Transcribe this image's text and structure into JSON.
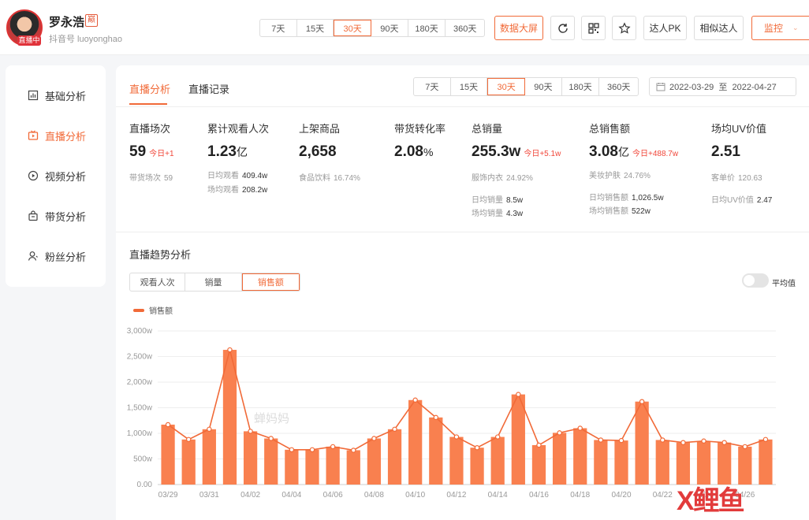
{
  "header": {
    "user_name": "罗永浩",
    "user_tag": "巅",
    "douyin_id": "抖音号 luoyonghao",
    "live_badge": "直播中",
    "period_options": [
      "7天",
      "15天",
      "30天",
      "90天",
      "180天",
      "360天"
    ],
    "period_active": "30天",
    "big_screen_label": "数据大屏",
    "pk_label": "达人PK",
    "similar_label": "相似达人",
    "monitor_label": "监控"
  },
  "sidebar": {
    "items": [
      {
        "label": "基础分析",
        "icon": "chart-icon"
      },
      {
        "label": "直播分析",
        "icon": "live-icon",
        "active": true
      },
      {
        "label": "视频分析",
        "icon": "play-icon"
      },
      {
        "label": "带货分析",
        "icon": "bag-icon"
      },
      {
        "label": "粉丝分析",
        "icon": "user-icon"
      }
    ]
  },
  "main": {
    "tabs": [
      "直播分析",
      "直播记录"
    ],
    "period_options": [
      "7天",
      "15天",
      "30天",
      "90天",
      "180天",
      "360天"
    ],
    "date_range": "2022-03-29  至  2022-04-27",
    "metrics": {
      "m1": {
        "label": "直播场次",
        "value": "59",
        "delta": "今日+1",
        "sub1_label": "带货场次",
        "sub1_value": "59"
      },
      "m2": {
        "label": "累计观看人次",
        "value": "1.23",
        "unit": "亿",
        "sub1_label": "日均观看",
        "sub1_value": "409.4w",
        "sub2_label": "场均观看",
        "sub2_value": "208.2w"
      },
      "m3": {
        "label": "上架商品",
        "value": "2,658",
        "sub1_label": "食品饮料",
        "sub1_value": "16.74%"
      },
      "m4": {
        "label": "带货转化率",
        "value": "2.08",
        "unit": "%"
      },
      "m5": {
        "label": "总销量",
        "value": "255.3w",
        "delta": "今日+5.1w",
        "sub1_label": "服饰内衣",
        "sub1_value": "24.92%",
        "sub2_label": "日均销量",
        "sub2_value": "8.5w",
        "sub3_label": "场均销量",
        "sub3_value": "4.3w"
      },
      "m6": {
        "label": "总销售额",
        "value": "3.08",
        "unit": "亿",
        "delta": "今日+488.7w",
        "sub1_label": "美妆护肤",
        "sub1_value": "24.76%",
        "sub2_label": "日均销售额",
        "sub2_value": "1,026.5w",
        "sub3_label": "场均销售额",
        "sub3_value": "522w"
      },
      "m7": {
        "label": "场均UV价值",
        "value": "2.51",
        "sub1_label": "客单价",
        "sub1_value": "120.63",
        "sub2_label": "日均UV价值",
        "sub2_value": "2.47"
      }
    },
    "trend_title": "直播趋势分析",
    "chart_tabs": [
      "观看人次",
      "销量",
      "销售额"
    ],
    "chart_tab_active": "销售额",
    "avg_toggle_label": "平均值",
    "legend_label": "销售额"
  },
  "chart_data": {
    "type": "bar",
    "series": [
      {
        "name": "销售额",
        "values": [
          1170,
          880,
          1080,
          2630,
          1040,
          900,
          680,
          680,
          740,
          670,
          900,
          1080,
          1650,
          1310,
          930,
          720,
          930,
          1760,
          770,
          1010,
          1100,
          870,
          860,
          1620,
          870,
          820,
          850,
          820,
          740,
          880
        ]
      }
    ],
    "categories": [
      "03/29",
      "03/30",
      "03/31",
      "04/01",
      "04/02",
      "04/03",
      "04/04",
      "04/05",
      "04/06",
      "04/07",
      "04/08",
      "04/09",
      "04/10",
      "04/11",
      "04/12",
      "04/13",
      "04/14",
      "04/15",
      "04/16",
      "04/17",
      "04/18",
      "04/19",
      "04/20",
      "04/21",
      "04/22",
      "04/23",
      "04/24",
      "04/25",
      "04/26",
      "04/27"
    ],
    "x_tick_labels": [
      "03/29",
      "03/31",
      "04/02",
      "04/04",
      "04/06",
      "04/08",
      "04/10",
      "04/12",
      "04/14",
      "04/16",
      "04/18",
      "04/20",
      "04/22",
      "04/24",
      "04/26"
    ],
    "y_tick_labels": [
      "0.00",
      "500w",
      "1,000w",
      "1,500w",
      "2,000w",
      "2,500w",
      "3,000w"
    ],
    "ylim": [
      0,
      3000
    ],
    "line_overlay": true,
    "watermark": "蝉妈妈",
    "colors": {
      "bar": "#f9804f",
      "line": "#f16a38"
    }
  },
  "corner_watermark": "X鲤鱼"
}
